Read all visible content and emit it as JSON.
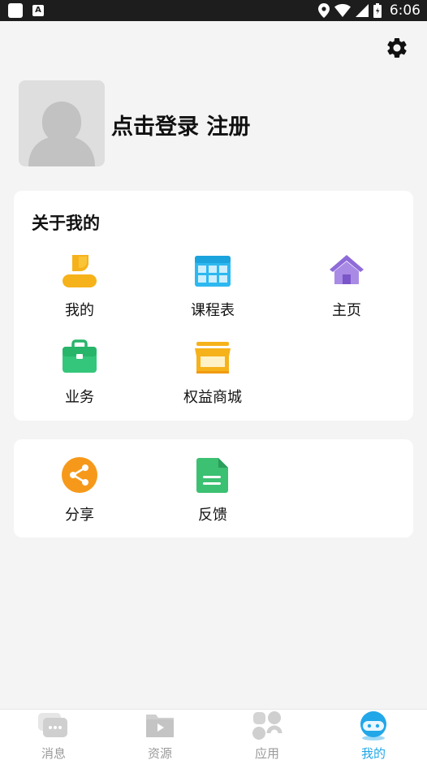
{
  "status_bar": {
    "time": "6:06",
    "left_icons": [
      "app-icon",
      "a-icon"
    ],
    "right_icons": [
      "location-icon",
      "wifi-icon",
      "signal-icon",
      "battery-icon"
    ]
  },
  "header": {
    "settings_icon": "gear-icon",
    "avatar_icon": "user-silhouette-icon",
    "login_label": "点击登录 注册"
  },
  "about_section": {
    "title": "关于我的",
    "items": [
      {
        "label": "我的",
        "icon": "profile-icon"
      },
      {
        "label": "课程表",
        "icon": "timetable-icon"
      },
      {
        "label": "主页",
        "icon": "home-icon"
      },
      {
        "label": "业务",
        "icon": "briefcase-icon"
      },
      {
        "label": "权益商城",
        "icon": "shop-icon"
      }
    ]
  },
  "extra_section": {
    "items": [
      {
        "label": "分享",
        "icon": "share-icon"
      },
      {
        "label": "反馈",
        "icon": "feedback-document-icon"
      }
    ]
  },
  "tab_bar": {
    "tabs": [
      {
        "label": "消息",
        "icon": "message-icon",
        "active": false
      },
      {
        "label": "资源",
        "icon": "video-folder-icon",
        "active": false
      },
      {
        "label": "应用",
        "icon": "apps-icon",
        "active": false
      },
      {
        "label": "我的",
        "icon": "face-icon",
        "active": true
      }
    ],
    "active_color": "#22a7e8",
    "inactive_color": "#9a9a9a"
  }
}
